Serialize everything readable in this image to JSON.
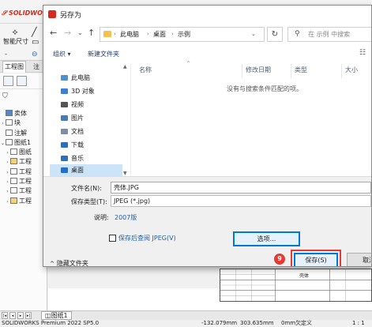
{
  "app": {
    "logo_text": "SOLIDWORKS",
    "toolbar": {
      "smart_dim_label": "智能尺寸",
      "minus_label": "-"
    },
    "tabs": [
      {
        "label": "工程图"
      },
      {
        "label": "注"
      }
    ],
    "tree": [
      {
        "label": "卖体",
        "arrow": ""
      },
      {
        "label": "块",
        "arrow": "›"
      },
      {
        "label": "注解",
        "arrow": ""
      },
      {
        "label": "图纸1",
        "arrow": "⌄"
      },
      {
        "label": "图纸",
        "arrow": "›"
      },
      {
        "label": "工程",
        "arrow": "›"
      },
      {
        "label": "工程",
        "arrow": "›"
      },
      {
        "label": "工程",
        "arrow": "›"
      },
      {
        "label": "工程",
        "arrow": "›"
      },
      {
        "label": "工程",
        "arrow": "›"
      }
    ],
    "title_block_text": "壳体",
    "sheet_tab": "图纸1",
    "status": {
      "product": "SOLIDWORKS Premium 2022 SP5.0",
      "x_coord": "-132.079mm",
      "y_coord": "303.635mm",
      "z_coord": "0mm",
      "state": "欠定义",
      "scale": "1 : 1"
    }
  },
  "dialog": {
    "title": "另存为",
    "nav": {
      "back": "←",
      "forward": "→",
      "recent": "⌄",
      "up": "↑"
    },
    "breadcrumbs": [
      "此电脑",
      "桌面",
      "示例"
    ],
    "search_placeholder": "在 示例 中搜索",
    "commands": {
      "organize": "组织 ▾",
      "new_folder": "新建文件夹"
    },
    "nav_items": [
      {
        "label": "此电脑",
        "icon_color": "#4a90d9",
        "selected": false
      },
      {
        "label": "3D 对象",
        "icon_color": "#3b7dd8",
        "selected": false
      },
      {
        "label": "视频",
        "icon_color": "#555555",
        "selected": false
      },
      {
        "label": "图片",
        "icon_color": "#4a7bb5",
        "selected": false
      },
      {
        "label": "文档",
        "icon_color": "#7a8ea8",
        "selected": false
      },
      {
        "label": "下载",
        "icon_color": "#2b6fc4",
        "selected": false
      },
      {
        "label": "音乐",
        "icon_color": "#2b6fc4",
        "selected": false
      },
      {
        "label": "桌面",
        "icon_color": "#1f6fd1",
        "selected": true
      }
    ],
    "columns": [
      {
        "label": "名称"
      },
      {
        "label": "修改日期"
      },
      {
        "label": "类型"
      },
      {
        "label": "大小"
      }
    ],
    "empty_message": "没有与搜索条件匹配的项。",
    "form": {
      "filename_label": "文件名(N):",
      "filename_value": "壳体.JPG",
      "filetype_label": "保存类型(T):",
      "filetype_value": "JPEG (*.jpg)",
      "description_label": "说明:",
      "description_value": "2007版",
      "preview_checkbox_label": "保存后查阅 JPEG(V)",
      "options_button": "选项...",
      "hide_folders": "隐藏文件夹",
      "save_button": "保存(S)",
      "cancel_button": "取消"
    },
    "step_badge": "9"
  },
  "colors": {
    "accent": "#0078d7",
    "highlight": "#e53935",
    "link": "#1f5fa8",
    "brand": "#d52b1e"
  }
}
